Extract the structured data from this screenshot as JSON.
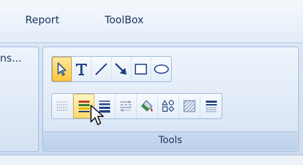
{
  "menu": {
    "items": [
      {
        "label": "Report"
      },
      {
        "label": "ToolBox"
      }
    ]
  },
  "left_group": {
    "text": "ns..."
  },
  "tools_group": {
    "caption": "Tools",
    "row1": [
      "pointer-icon",
      "text-icon",
      "line-icon",
      "arrow-icon",
      "rectangle-icon",
      "ellipse-icon"
    ],
    "row2": [
      "line-style-dotted-icon",
      "line-color-icon",
      "line-weight-icon",
      "line-dash-icon",
      "fill-color-icon",
      "shapes-icon",
      "pattern-icon",
      "border-pattern-icon"
    ]
  },
  "colors": {
    "active": "#ffc63d",
    "text": "#1e3560"
  }
}
